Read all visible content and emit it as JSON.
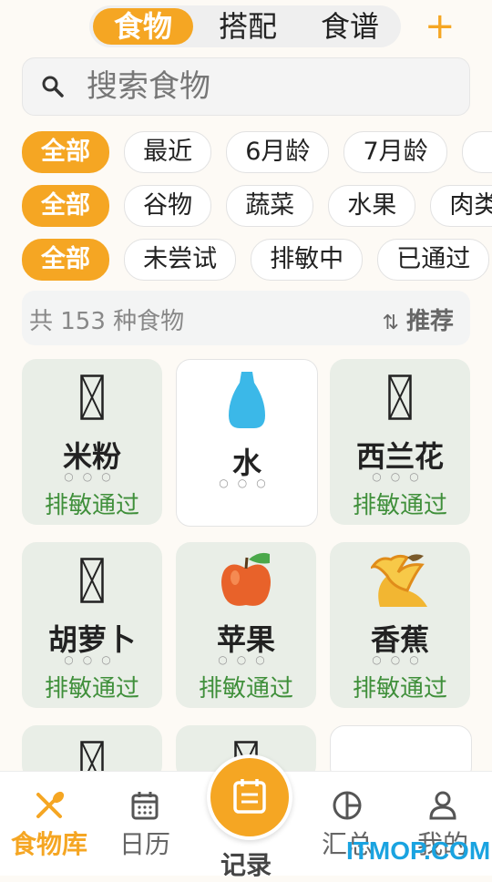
{
  "top_tabs": {
    "food": "食物",
    "pairing": "搭配",
    "recipes": "食谱",
    "add": "+"
  },
  "search": {
    "placeholder": "搜索食物"
  },
  "filters": {
    "age": [
      "全部",
      "最近",
      "6月龄",
      "7月龄",
      ""
    ],
    "category": [
      "全部",
      "谷物",
      "蔬菜",
      "水果",
      "肉类"
    ],
    "status": [
      "全部",
      "未尝试",
      "排敏中",
      "已通过"
    ]
  },
  "summary": {
    "count": "共 153 种食物",
    "sort": "推荐"
  },
  "foods": [
    {
      "name": "米粉",
      "status": "排敏通过",
      "dots": "○○○",
      "icon": "placeholder-icon"
    },
    {
      "name": "水",
      "status": "",
      "dots": "○○○",
      "icon": "water-drop-icon"
    },
    {
      "name": "西兰花",
      "status": "排敏通过",
      "dots": "○○○",
      "icon": "placeholder-icon"
    },
    {
      "name": "胡萝卜",
      "status": "排敏通过",
      "dots": "○○○",
      "icon": "placeholder-icon"
    },
    {
      "name": "苹果",
      "status": "排敏通过",
      "dots": "○○○",
      "icon": "apple-icon"
    },
    {
      "name": "香蕉",
      "status": "排敏通过",
      "dots": "○○○",
      "icon": "banana-icon"
    }
  ],
  "nav": {
    "library": "食物库",
    "calendar": "日历",
    "record": "记录",
    "summary": "汇总",
    "me": "我的"
  },
  "watermark": "ITMOP.COM",
  "colors": {
    "accent": "#f5a623",
    "passed": "#3f8f3a",
    "card_bg": "#e9eee7"
  }
}
